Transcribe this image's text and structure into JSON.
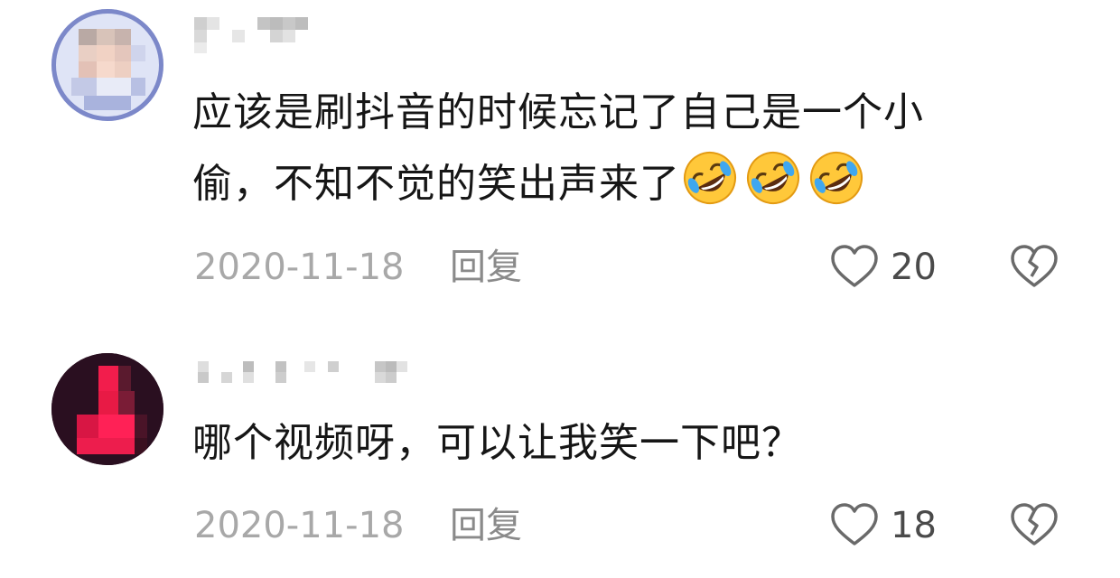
{
  "comments": [
    {
      "username": "",
      "avatar_icon": "pixelated-avatar",
      "text_line1": "应该是刷抖音的时候忘记了自己是一个小",
      "text_line2": "偷，不知不觉的笑出声来了",
      "emojis": [
        "rofl-emoji",
        "rofl-emoji",
        "rofl-emoji"
      ],
      "date": "2020-11-18",
      "reply_label": "回复",
      "like_count": "20"
    },
    {
      "username": "",
      "avatar_icon": "pixelated-avatar",
      "text_line1": "哪个视频呀，可以让我笑一下吧？",
      "date": "2020-11-18",
      "reply_label": "回复",
      "like_count": "18"
    }
  ],
  "colors": {
    "text": "#161616",
    "meta": "#a8a8a8",
    "icon": "#6a6a6a",
    "emoji_face": "#ffc83a"
  }
}
